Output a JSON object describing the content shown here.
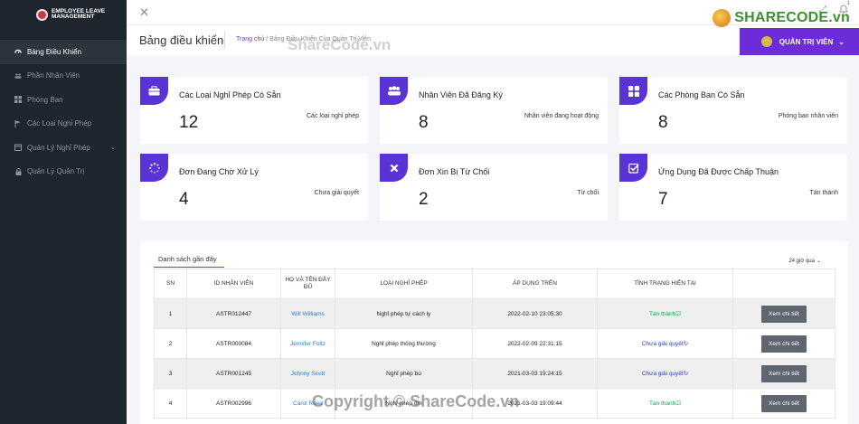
{
  "brand": {
    "title": "Employee Leave Management"
  },
  "sidebar": {
    "items": [
      {
        "label": "Bảng Điều Khiển",
        "icon": "dashboard-icon"
      },
      {
        "label": "Phần Nhân Viên",
        "icon": "users-icon"
      },
      {
        "label": "Phòng Ban",
        "icon": "grid-icon"
      },
      {
        "label": "Các Loại Nghỉ Phép",
        "icon": "flag-icon"
      },
      {
        "label": "Quản Lý Nghỉ Phép",
        "icon": "calendar-icon"
      },
      {
        "label": "Quản Lý Quản Trị",
        "icon": "lock-icon"
      }
    ]
  },
  "header": {
    "title": "Bảng điều khiển",
    "breadcrumb_home": "Trang chủ",
    "breadcrumb_sep": "/",
    "breadcrumb_current": "Bảng Điều Khiển Của Quản Trị Viên",
    "admin_label": "QUẢN TRỊ VIÊN"
  },
  "watermark": {
    "brand": "SHARECODE.vn",
    "top": "ShareCode.vn",
    "bottom": "Copyright © ShareCode.vn"
  },
  "notifications": {
    "count": "1"
  },
  "cards": [
    {
      "title": "Các Loại Nghỉ Phép Có Sẵn",
      "value": "12",
      "sub": "Các loại nghỉ phép",
      "icon": "briefcase-icon"
    },
    {
      "title": "Nhân Viên Đã Đăng Ký",
      "value": "8",
      "sub": "Nhân viên đang hoạt động",
      "icon": "users-icon"
    },
    {
      "title": "Các Phòng Ban Có Sẵn",
      "value": "8",
      "sub": "Phòng ban nhân viên",
      "icon": "grid-icon"
    },
    {
      "title": "Đơn Đang Chờ Xử Lý",
      "value": "4",
      "sub": "Chưa giải quyết",
      "icon": "spinner-icon"
    },
    {
      "title": "Đơn Xin Bị Từ Chối",
      "value": "2",
      "sub": "Từ chối",
      "icon": "x-icon"
    },
    {
      "title": "Ứng Dụng Đã Được Chấp Thuận",
      "value": "7",
      "sub": "Tán thành",
      "icon": "check-square-icon"
    }
  ],
  "table": {
    "tab": "Danh sách gần đây",
    "filter": "24 giờ qua",
    "headers": [
      "SN",
      "ID NHÂN VIÊN",
      "HỌ VÀ TÊN ĐẦY ĐỦ",
      "LOẠI NGHỈ PHÉP",
      "ÁP DỤNG TRÊN",
      "TÌNH TRẠNG HIỆN TẠI",
      ""
    ],
    "button": "Xem chi tiết",
    "rows": [
      {
        "sn": "1",
        "id": "ASTR012447",
        "name": "Will Williams",
        "type": "Nghỉ phép tự cách ly",
        "date": "2022-02-10 23:05:30",
        "status": "Tán thành",
        "status_kind": "ok"
      },
      {
        "sn": "2",
        "id": "ASTR000084",
        "name": "Jennifer Foltz",
        "type": "Nghỉ phép thông thường",
        "date": "2022-02-09 22:31:15",
        "status": "Chưa giải quyết",
        "status_kind": "pending"
      },
      {
        "sn": "3",
        "id": "ASTR001245",
        "name": "Johnny Scott",
        "type": "Nghỉ phép bù",
        "date": "2021-03-03 19:24:15",
        "status": "Chưa giải quyết",
        "status_kind": "pending"
      },
      {
        "sn": "4",
        "id": "ASTR002996",
        "name": "Carol Reed",
        "type": "Nghỉ phép ốm",
        "date": "2021-03-03 19:09:44",
        "status": "Tán thành",
        "status_kind": "ok"
      }
    ]
  }
}
